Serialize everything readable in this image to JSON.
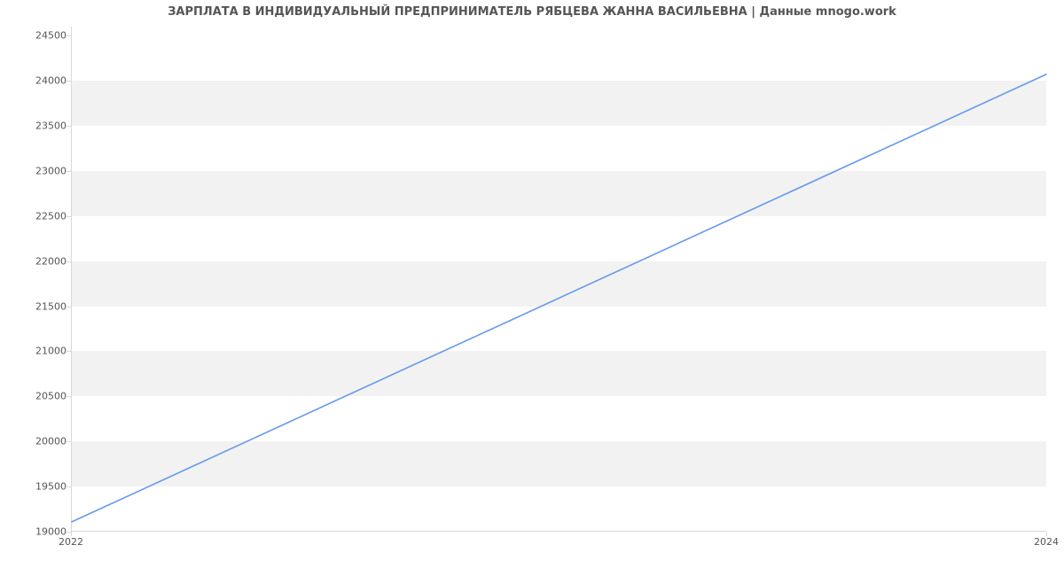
{
  "chart_data": {
    "type": "line",
    "title": "ЗАРПЛАТА В ИНДИВИДУАЛЬНЫЙ ПРЕДПРИНИМАТЕЛЬ РЯБЦЕВА ЖАННА ВАСИЛЬЕВНА | Данные mnogo.work",
    "x": [
      2022,
      2024
    ],
    "values": [
      19100,
      24070
    ],
    "xlim": [
      2022,
      2024
    ],
    "ylim": [
      19000,
      24600
    ],
    "yticks": [
      19000,
      19500,
      20000,
      20500,
      21000,
      21500,
      22000,
      22500,
      23000,
      23500,
      24000,
      24500
    ],
    "xticks": [
      2022,
      2024
    ],
    "xlabel": "",
    "ylabel": ""
  },
  "colors": {
    "series": "#6699ea",
    "band": "#f2f2f2",
    "axis": "#d9d9d9",
    "text": "#555555"
  }
}
